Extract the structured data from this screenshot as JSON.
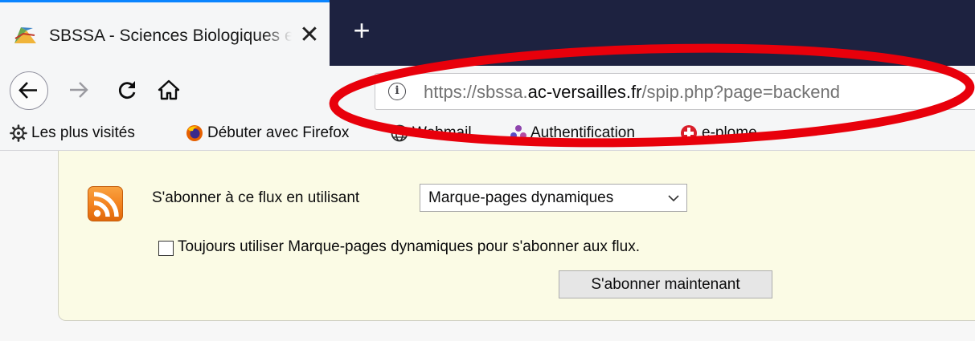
{
  "browser": {
    "tab": {
      "title": "SBSSA - Sciences Biologiques et Sciences Sociales Appliquées",
      "close_glyph": "✕"
    },
    "newtab_glyph": "+",
    "url": {
      "prefix": "https://sbssa.",
      "domain": "ac-versailles.fr",
      "path": "/spip.php?page=backend"
    },
    "bookmarks": [
      {
        "label": "Les plus visités",
        "icon": "gear-icon"
      },
      {
        "label": "Débuter avec Firefox",
        "icon": "firefox-icon"
      },
      {
        "label": "Webmail",
        "icon": "globe-icon"
      },
      {
        "label": "Authentification",
        "icon": "puzzle-icon"
      },
      {
        "label": "e-plome",
        "icon": "red-circle-icon"
      }
    ],
    "annotation_color": "#e8000b"
  },
  "feed": {
    "subscribe_label": "S'abonner à ce flux en utilisant",
    "reader_selected": "Marque-pages dynamiques",
    "always_use_label": "Toujours utiliser Marque-pages dynamiques pour s'abonner aux flux.",
    "always_use_checked": false,
    "subscribe_button": "S'abonner maintenant"
  }
}
